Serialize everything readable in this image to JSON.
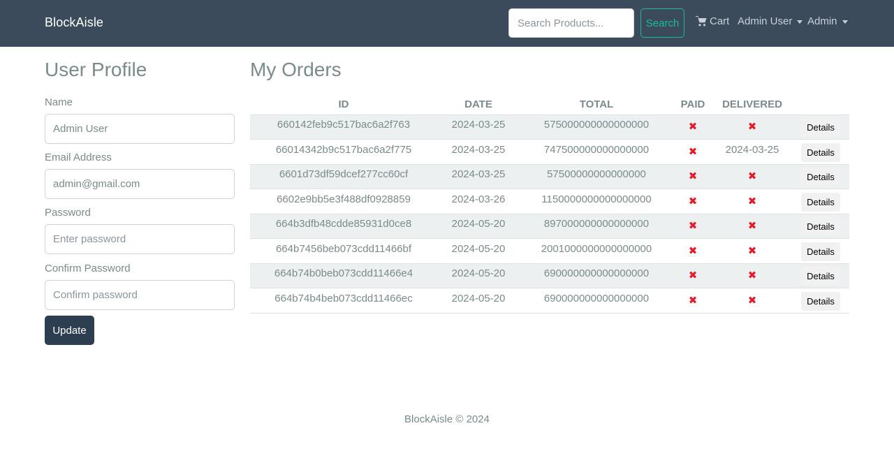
{
  "navbar": {
    "brand": "BlockAisle",
    "search_placeholder": "Search Products...",
    "search_button": "Search",
    "cart_label": "Cart",
    "user_menu_label": "Admin User",
    "admin_menu_label": "Admin"
  },
  "profile": {
    "title": "User Profile",
    "name_label": "Name",
    "name_value": "Admin User",
    "email_label": "Email Address",
    "email_value": "admin@gmail.com",
    "password_label": "Password",
    "password_placeholder": "Enter password",
    "confirm_label": "Confirm Password",
    "confirm_placeholder": "Confirm password",
    "update_button": "Update"
  },
  "orders": {
    "title": "My Orders",
    "columns": [
      "ID",
      "DATE",
      "TOTAL",
      "PAID",
      "DELIVERED",
      ""
    ],
    "details_label": "Details",
    "rows": [
      {
        "id": "660142feb9c517bac6a2f763",
        "date": "2024-03-25",
        "total": "575000000000000000",
        "paid": null,
        "delivered": null
      },
      {
        "id": "66014342b9c517bac6a2f775",
        "date": "2024-03-25",
        "total": "747500000000000000",
        "paid": null,
        "delivered": "2024-03-25"
      },
      {
        "id": "6601d73df59dcef277cc60cf",
        "date": "2024-03-25",
        "total": "57500000000000000",
        "paid": null,
        "delivered": null
      },
      {
        "id": "6602e9bb5e3f488df0928859",
        "date": "2024-03-26",
        "total": "1150000000000000000",
        "paid": null,
        "delivered": null
      },
      {
        "id": "664b3dfb48cdde85931d0ce8",
        "date": "2024-05-20",
        "total": "897000000000000000",
        "paid": null,
        "delivered": null
      },
      {
        "id": "664b7456beb073cdd11466bf",
        "date": "2024-05-20",
        "total": "2001000000000000000",
        "paid": null,
        "delivered": null
      },
      {
        "id": "664b74b0beb073cdd11466e4",
        "date": "2024-05-20",
        "total": "690000000000000000",
        "paid": null,
        "delivered": null
      },
      {
        "id": "664b74b4beb073cdd11466ec",
        "date": "2024-05-20",
        "total": "690000000000000000",
        "paid": null,
        "delivered": null
      }
    ]
  },
  "footer": {
    "text": "BlockAisle © 2024"
  },
  "colors": {
    "navbar_bg": "#3c4b5b",
    "accent": "#18bc9c",
    "primary_button": "#2c3e50",
    "not_status_icon": "#e31b2b",
    "text_muted": "#7b8a8b"
  },
  "icons": {
    "cart": "cart-icon",
    "not_paid": "x-icon",
    "dropdown": "caret-down-icon"
  }
}
